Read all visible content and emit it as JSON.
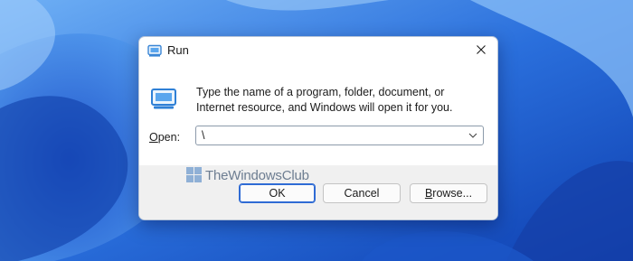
{
  "dialog": {
    "title": "Run",
    "description": "Type the name of a program, folder, document, or Internet resource, and Windows will open it for you.",
    "open_label_prefix": "O",
    "open_label_rest": "pen:",
    "open_value": "\\",
    "buttons": {
      "ok": "OK",
      "cancel": "Cancel",
      "browse_prefix": "B",
      "browse_rest": "rowse..."
    }
  },
  "watermark": {
    "text": "TheWindowsClub"
  },
  "icons": {
    "title": "run-icon",
    "big": "run-icon",
    "close": "close-icon",
    "dropdown": "chevron-down-icon",
    "watermark": "windowsclub-logo"
  },
  "colors": {
    "wallpaper": "#3a7fe0",
    "dialog_bg": "#ffffff",
    "footer_bg": "#f0f0f0",
    "accent": "#2f6bd4"
  }
}
